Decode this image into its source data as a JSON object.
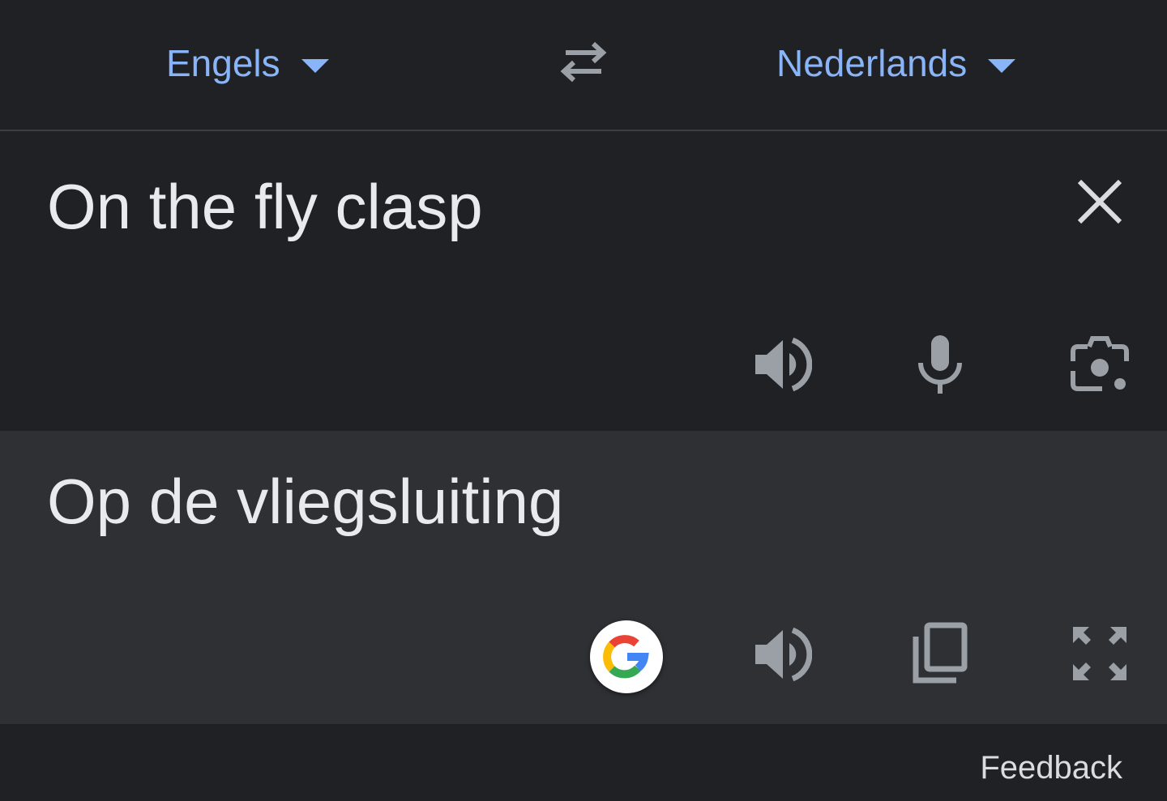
{
  "header": {
    "source_language": "Engels",
    "target_language": "Nederlands",
    "swap_icon": "swap-arrows-icon",
    "dropdown_icon": "caret-down-icon"
  },
  "source": {
    "text": "On the fly clasp",
    "icons": [
      "close-icon",
      "speaker-icon",
      "microphone-icon",
      "camera-icon"
    ]
  },
  "target": {
    "text": "Op de vliegsluiting",
    "icons": [
      "google-g-icon",
      "speaker-icon",
      "copy-icon",
      "fullscreen-icon"
    ]
  },
  "footer": {
    "feedback_label": "Feedback"
  },
  "colors": {
    "background": "#202124",
    "result_panel": "#2e3034",
    "accent": "#8ab4f8",
    "text": "#e8eaed",
    "icon": "#9aa0a6"
  }
}
